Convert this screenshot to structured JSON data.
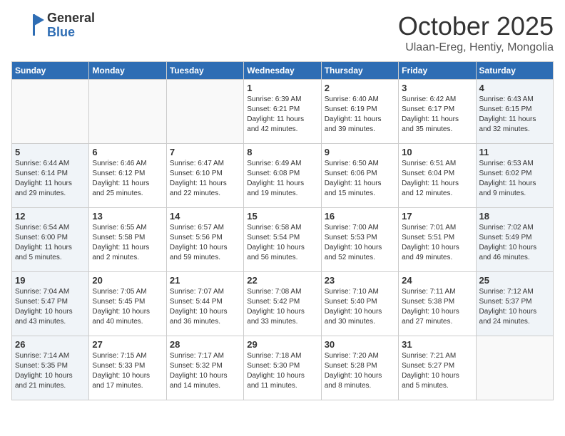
{
  "logo": {
    "general": "General",
    "blue": "Blue"
  },
  "title": "October 2025",
  "subtitle": "Ulaan-Ereg, Hentiy, Mongolia",
  "weekdays": [
    "Sunday",
    "Monday",
    "Tuesday",
    "Wednesday",
    "Thursday",
    "Friday",
    "Saturday"
  ],
  "weeks": [
    [
      {
        "day": "",
        "info": ""
      },
      {
        "day": "",
        "info": ""
      },
      {
        "day": "",
        "info": ""
      },
      {
        "day": "1",
        "info": "Sunrise: 6:39 AM\nSunset: 6:21 PM\nDaylight: 11 hours\nand 42 minutes."
      },
      {
        "day": "2",
        "info": "Sunrise: 6:40 AM\nSunset: 6:19 PM\nDaylight: 11 hours\nand 39 minutes."
      },
      {
        "day": "3",
        "info": "Sunrise: 6:42 AM\nSunset: 6:17 PM\nDaylight: 11 hours\nand 35 minutes."
      },
      {
        "day": "4",
        "info": "Sunrise: 6:43 AM\nSunset: 6:15 PM\nDaylight: 11 hours\nand 32 minutes."
      }
    ],
    [
      {
        "day": "5",
        "info": "Sunrise: 6:44 AM\nSunset: 6:14 PM\nDaylight: 11 hours\nand 29 minutes."
      },
      {
        "day": "6",
        "info": "Sunrise: 6:46 AM\nSunset: 6:12 PM\nDaylight: 11 hours\nand 25 minutes."
      },
      {
        "day": "7",
        "info": "Sunrise: 6:47 AM\nSunset: 6:10 PM\nDaylight: 11 hours\nand 22 minutes."
      },
      {
        "day": "8",
        "info": "Sunrise: 6:49 AM\nSunset: 6:08 PM\nDaylight: 11 hours\nand 19 minutes."
      },
      {
        "day": "9",
        "info": "Sunrise: 6:50 AM\nSunset: 6:06 PM\nDaylight: 11 hours\nand 15 minutes."
      },
      {
        "day": "10",
        "info": "Sunrise: 6:51 AM\nSunset: 6:04 PM\nDaylight: 11 hours\nand 12 minutes."
      },
      {
        "day": "11",
        "info": "Sunrise: 6:53 AM\nSunset: 6:02 PM\nDaylight: 11 hours\nand 9 minutes."
      }
    ],
    [
      {
        "day": "12",
        "info": "Sunrise: 6:54 AM\nSunset: 6:00 PM\nDaylight: 11 hours\nand 5 minutes."
      },
      {
        "day": "13",
        "info": "Sunrise: 6:55 AM\nSunset: 5:58 PM\nDaylight: 11 hours\nand 2 minutes."
      },
      {
        "day": "14",
        "info": "Sunrise: 6:57 AM\nSunset: 5:56 PM\nDaylight: 10 hours\nand 59 minutes."
      },
      {
        "day": "15",
        "info": "Sunrise: 6:58 AM\nSunset: 5:54 PM\nDaylight: 10 hours\nand 56 minutes."
      },
      {
        "day": "16",
        "info": "Sunrise: 7:00 AM\nSunset: 5:53 PM\nDaylight: 10 hours\nand 52 minutes."
      },
      {
        "day": "17",
        "info": "Sunrise: 7:01 AM\nSunset: 5:51 PM\nDaylight: 10 hours\nand 49 minutes."
      },
      {
        "day": "18",
        "info": "Sunrise: 7:02 AM\nSunset: 5:49 PM\nDaylight: 10 hours\nand 46 minutes."
      }
    ],
    [
      {
        "day": "19",
        "info": "Sunrise: 7:04 AM\nSunset: 5:47 PM\nDaylight: 10 hours\nand 43 minutes."
      },
      {
        "day": "20",
        "info": "Sunrise: 7:05 AM\nSunset: 5:45 PM\nDaylight: 10 hours\nand 40 minutes."
      },
      {
        "day": "21",
        "info": "Sunrise: 7:07 AM\nSunset: 5:44 PM\nDaylight: 10 hours\nand 36 minutes."
      },
      {
        "day": "22",
        "info": "Sunrise: 7:08 AM\nSunset: 5:42 PM\nDaylight: 10 hours\nand 33 minutes."
      },
      {
        "day": "23",
        "info": "Sunrise: 7:10 AM\nSunset: 5:40 PM\nDaylight: 10 hours\nand 30 minutes."
      },
      {
        "day": "24",
        "info": "Sunrise: 7:11 AM\nSunset: 5:38 PM\nDaylight: 10 hours\nand 27 minutes."
      },
      {
        "day": "25",
        "info": "Sunrise: 7:12 AM\nSunset: 5:37 PM\nDaylight: 10 hours\nand 24 minutes."
      }
    ],
    [
      {
        "day": "26",
        "info": "Sunrise: 7:14 AM\nSunset: 5:35 PM\nDaylight: 10 hours\nand 21 minutes."
      },
      {
        "day": "27",
        "info": "Sunrise: 7:15 AM\nSunset: 5:33 PM\nDaylight: 10 hours\nand 17 minutes."
      },
      {
        "day": "28",
        "info": "Sunrise: 7:17 AM\nSunset: 5:32 PM\nDaylight: 10 hours\nand 14 minutes."
      },
      {
        "day": "29",
        "info": "Sunrise: 7:18 AM\nSunset: 5:30 PM\nDaylight: 10 hours\nand 11 minutes."
      },
      {
        "day": "30",
        "info": "Sunrise: 7:20 AM\nSunset: 5:28 PM\nDaylight: 10 hours\nand 8 minutes."
      },
      {
        "day": "31",
        "info": "Sunrise: 7:21 AM\nSunset: 5:27 PM\nDaylight: 10 hours\nand 5 minutes."
      },
      {
        "day": "",
        "info": ""
      }
    ]
  ]
}
